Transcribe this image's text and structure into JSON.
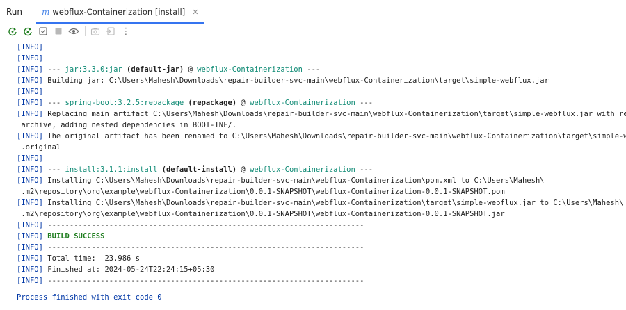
{
  "header": {
    "run_label": "Run",
    "tab": {
      "icon_glyph": "m",
      "icon_name": "maven-icon",
      "title": "webflux-Containerization [install]",
      "close_glyph": "✕"
    }
  },
  "toolbar": {
    "buttons": [
      {
        "name": "rerun-icon"
      },
      {
        "name": "rerun-failed-icon"
      },
      {
        "name": "toggle-tree-icon"
      },
      {
        "name": "stop-icon"
      },
      {
        "name": "view-options-icon"
      },
      {
        "name": "screenshot-icon"
      },
      {
        "name": "restore-layout-icon"
      },
      {
        "name": "more-options-icon"
      }
    ],
    "more_glyph": "⋮"
  },
  "colors": {
    "accent": "#3574f0",
    "info": "#0037a6",
    "plugin": "#0e8a74",
    "success": "#1e7d1e"
  },
  "console": {
    "level": "[INFO]",
    "lines": [
      {
        "text": ""
      },
      {
        "text": ""
      },
      {
        "prefix": " --- ",
        "plugin": "jar:3.3.0:jar",
        "goal": " (default-jar)",
        "at": " @ ",
        "project": "webflux-Containerization",
        "suffix": " ---"
      },
      {
        "text": " Building jar: C:\\Users\\Mahesh\\Downloads\\repair-builder-svc-main\\webflux-Containerization\\target\\simple-webflux.jar"
      },
      {
        "text": ""
      },
      {
        "prefix": " --- ",
        "plugin": "spring-boot:3.2.5:repackage",
        "goal": " (repackage)",
        "at": " @ ",
        "project": "webflux-Containerization",
        "suffix": " ---"
      },
      {
        "text": " Replacing main artifact C:\\Users\\Mahesh\\Downloads\\repair-builder-svc-main\\webflux-Containerization\\target\\simple-webflux.jar with repackaged"
      },
      {
        "cont": "archive, adding nested dependencies in BOOT-INF/."
      },
      {
        "text": " The original artifact has been renamed to C:\\Users\\Mahesh\\Downloads\\repair-builder-svc-main\\webflux-Containerization\\target\\simple-webflux.jar"
      },
      {
        "cont": ".original"
      },
      {
        "text": ""
      },
      {
        "prefix": " --- ",
        "plugin": "install:3.1.1:install",
        "goal": " (default-install)",
        "at": " @ ",
        "project": "webflux-Containerization",
        "suffix": " ---"
      },
      {
        "text": " Installing C:\\Users\\Mahesh\\Downloads\\repair-builder-svc-main\\webflux-Containerization\\pom.xml to C:\\Users\\Mahesh\\"
      },
      {
        "cont": ".m2\\repository\\org\\example\\webflux-Containerization\\0.0.1-SNAPSHOT\\webflux-Containerization-0.0.1-SNAPSHOT.pom"
      },
      {
        "text": " Installing C:\\Users\\Mahesh\\Downloads\\repair-builder-svc-main\\webflux-Containerization\\target\\simple-webflux.jar to C:\\Users\\Mahesh\\"
      },
      {
        "cont": ".m2\\repository\\org\\example\\webflux-Containerization\\0.0.1-SNAPSHOT\\webflux-Containerization-0.0.1-SNAPSHOT.jar"
      },
      {
        "text": " ------------------------------------------------------------------------"
      },
      {
        "success": " BUILD SUCCESS"
      },
      {
        "text": " ------------------------------------------------------------------------"
      },
      {
        "text": " Total time:  23.986 s"
      },
      {
        "text": " Finished at: 2024-05-24T22:24:15+05:30"
      },
      {
        "text": " ------------------------------------------------------------------------"
      }
    ],
    "exit_message": "Process finished with exit code 0"
  }
}
